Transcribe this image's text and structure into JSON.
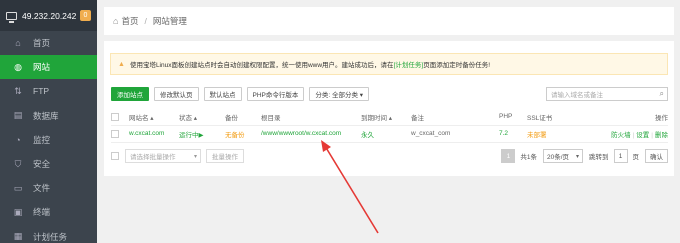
{
  "sidebar": {
    "server_ip": "49.232.20.242",
    "badge": "0",
    "items": [
      {
        "label": "首页",
        "icon": "home-icon",
        "glyph": "⌂"
      },
      {
        "label": "网站",
        "icon": "globe-icon",
        "glyph": "◍"
      },
      {
        "label": "FTP",
        "icon": "ftp-icon",
        "glyph": "⇅"
      },
      {
        "label": "数据库",
        "icon": "database-icon",
        "glyph": "▤"
      },
      {
        "label": "监控",
        "icon": "monitor-icon",
        "glyph": "◔"
      },
      {
        "label": "安全",
        "icon": "shield-icon",
        "glyph": "⛉"
      },
      {
        "label": "文件",
        "icon": "folder-icon",
        "glyph": "▭"
      },
      {
        "label": "终端",
        "icon": "terminal-icon",
        "glyph": "▣"
      },
      {
        "label": "计划任务",
        "icon": "calendar-icon",
        "glyph": "▦"
      }
    ]
  },
  "breadcrumb": {
    "home": "首页",
    "sep": "/",
    "current": "网站管理"
  },
  "notice": {
    "text_before": "使用宝塔Linux面板创建站点时会自动创建权限配置，统一使用www用户。建站成功后，请在",
    "link": "[计划任务]",
    "text_after": "页面添加定时备份任务!"
  },
  "toolbar": {
    "add_site": "添加站点",
    "default_page": "修改默认页",
    "default_site": "默认站点",
    "php_cli": "PHP命令行版本",
    "category": "分类: 全部分类 ▾",
    "search_placeholder": "请输入域名或备注"
  },
  "table": {
    "headers": [
      "网站名 ▴",
      "状态 ▴",
      "备份",
      "根目录",
      "到期时间 ▴",
      "备注",
      "PHP",
      "SSL证书",
      "操作"
    ],
    "row": {
      "name": "w.cxcat.com",
      "status": "运行中▶",
      "backup": "无备份",
      "root": "/www/wwwroot/w.cxcat.com",
      "expire": "永久",
      "remark": "w_cxcat_com",
      "php": "7.2",
      "ssl": "未部署",
      "ops": [
        "防火墙",
        "设置",
        "删除"
      ]
    }
  },
  "footer": {
    "batch_placeholder": "请选择批量操作",
    "batch_btn": "批量操作",
    "page": "1",
    "total": "共1条",
    "per_page": "20条/页",
    "jump_label": "跳转到",
    "jump_value": "1",
    "page_unit": "页",
    "confirm": "确认"
  },
  "colors": {
    "accent": "#20a53a",
    "arrow": "#e53935",
    "sidebar": "#3c444d"
  }
}
